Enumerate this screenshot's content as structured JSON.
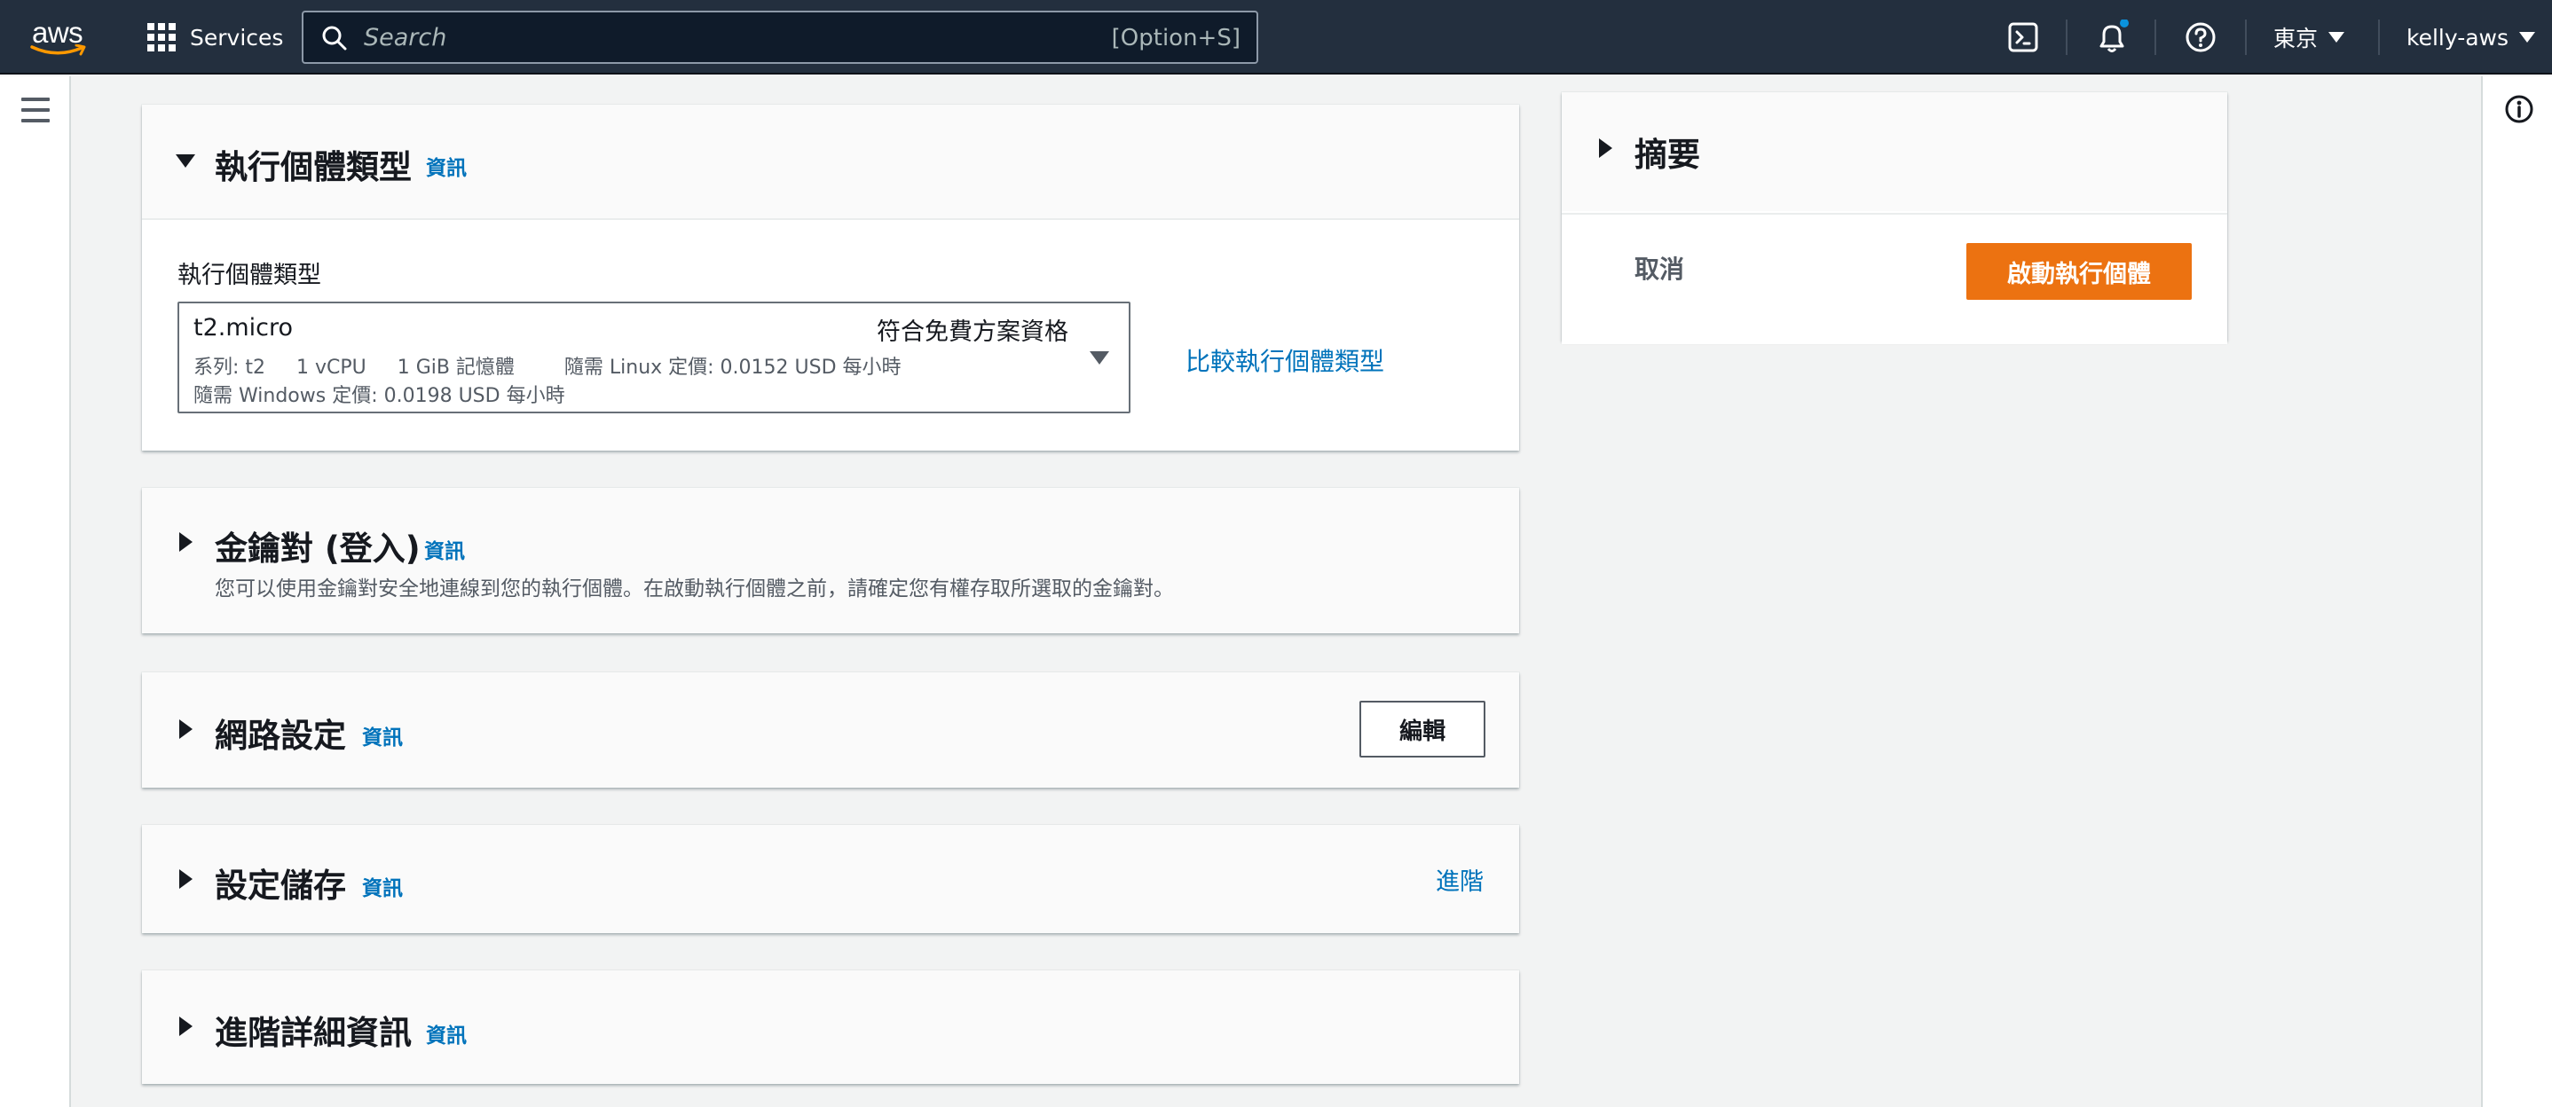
{
  "nav": {
    "logo": "aws",
    "services": "Services",
    "search_placeholder": "Search",
    "search_shortcut": "[Option+S]",
    "region": "東京",
    "account": "kelly-aws",
    "icons": [
      "cloudshell-icon",
      "bell-icon",
      "help-icon"
    ],
    "notification_dot_color": "#0a93dd"
  },
  "instance_type_panel": {
    "title": "執行個體類型",
    "info": "資訊",
    "field_label": "執行個體類型",
    "selected": {
      "name": "t2.micro",
      "tag": "符合免費方案資格",
      "desc_line1": "系列: t2     1 vCPU     1 GiB 記憶體        隨需 Linux 定價: 0.0152 USD 每小時",
      "desc_line2": "隨需 Windows 定價: 0.0198 USD 每小時"
    },
    "compare_link": "比較執行個體類型"
  },
  "key_pair_panel": {
    "title": "金鑰對 (登入)",
    "info": "資訊",
    "description": "您可以使用金鑰對安全地連線到您的執行個體。在啟動執行個體之前，請確定您有權存取所選取的金鑰對。"
  },
  "network_panel": {
    "title": "網路設定",
    "info": "資訊",
    "edit_button": "編輯"
  },
  "storage_panel": {
    "title": "設定儲存",
    "info": "資訊",
    "advanced_link": "進階"
  },
  "advanced_panel": {
    "title": "進階詳細資訊",
    "info": "資訊"
  },
  "summary_panel": {
    "title": "摘要",
    "cancel": "取消",
    "launch": "啟動執行個體"
  },
  "colors": {
    "nav_bg": "#232f3e",
    "link": "#0073bb",
    "primary": "#ec7211",
    "page_bg": "#f2f3f3"
  }
}
